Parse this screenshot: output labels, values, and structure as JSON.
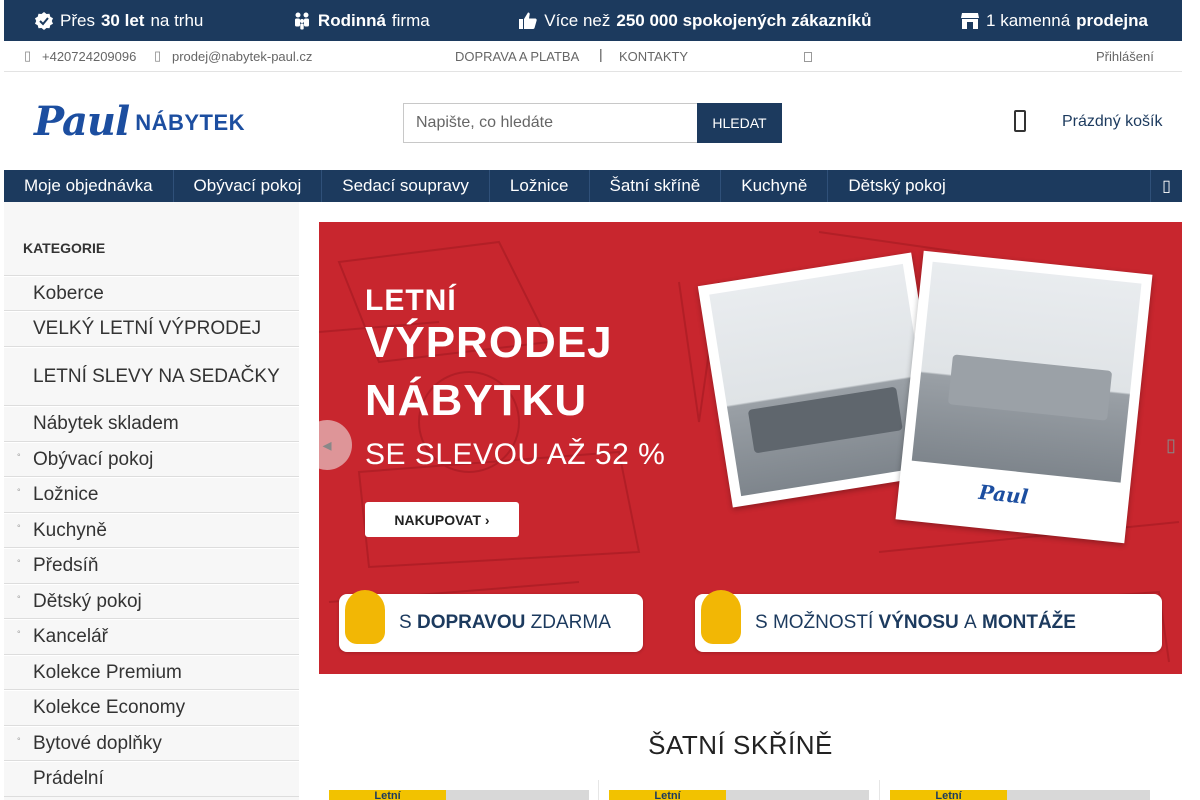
{
  "benefits": [
    {
      "icon": "badge-check-icon",
      "pre": "Přes",
      "bold": "30 let",
      "post": "na trhu"
    },
    {
      "icon": "family-icon",
      "pre": "",
      "bold": "Rodinná",
      "post": "firma"
    },
    {
      "icon": "thumbs-up-icon",
      "pre": "Více než",
      "bold": "250 000 spokojených zákazníků",
      "post": ""
    },
    {
      "icon": "store-icon",
      "pre": "1 kamenná",
      "bold": "prodejna",
      "post": ""
    }
  ],
  "contact": {
    "phone": "+420724209096",
    "email": "prodej@nabytek-paul.cz",
    "links": [
      "DOPRAVA A PLATBA",
      "KONTAKTY"
    ],
    "login": "Přihlášení"
  },
  "logo": {
    "script": "Paul",
    "text": "NÁBYTEK"
  },
  "search": {
    "placeholder": "Napište, co hledáte",
    "button": "HLEDAT"
  },
  "cart": {
    "label": "Prázdný košík"
  },
  "nav": [
    "Moje objednávka",
    "Obývací pokoj",
    "Sedací soupravy",
    "Ložnice",
    "Šatní skříně",
    "Kuchyně",
    "Dětský pokoj"
  ],
  "sidebar": {
    "title": "KATEGORIE",
    "items": [
      {
        "label": "Koberce",
        "has_children": false
      },
      {
        "label": "VELKÝ LETNÍ VÝPRODEJ",
        "has_children": false
      },
      {
        "label": "LETNÍ SLEVY NA SEDAČKY",
        "has_children": false
      },
      {
        "label": "Nábytek skladem",
        "has_children": false
      },
      {
        "label": "Obývací pokoj",
        "has_children": true
      },
      {
        "label": "Ložnice",
        "has_children": true
      },
      {
        "label": "Kuchyně",
        "has_children": true
      },
      {
        "label": "Předsíň",
        "has_children": true
      },
      {
        "label": "Dětský pokoj",
        "has_children": true
      },
      {
        "label": "Kancelář",
        "has_children": true
      },
      {
        "label": "Kolekce Premium",
        "has_children": false
      },
      {
        "label": "Kolekce Economy",
        "has_children": false
      },
      {
        "label": "Bytové doplňky",
        "has_children": true
      },
      {
        "label": "Prádelní",
        "has_children": false
      }
    ]
  },
  "banner": {
    "line1": "LETNÍ",
    "line2": "VÝPRODEJ",
    "line3": "NÁBYTKU",
    "line4": "SE SLEVOU AŽ 52 %",
    "cta": "NAKUPOVAT ›",
    "brand": "Paul",
    "pill1": {
      "pre": "S",
      "bold": "DOPRAVOU",
      "post": "ZDARMA"
    },
    "pill2": {
      "pre": "S MOŽNOSTÍ",
      "bold": "VÝNOSU",
      "mid": "A",
      "bold2": "MONTÁŽE"
    }
  },
  "section": {
    "title": "ŠATNÍ SKŘÍNĚ"
  },
  "products": [
    {
      "badge": "Letní"
    },
    {
      "badge": "Letní"
    },
    {
      "badge": "Letní"
    }
  ],
  "colors": {
    "navy": "#1c3a5e",
    "banner_red": "#c8262e",
    "accent_yellow": "#f2c200",
    "brand_blue": "#1c4ea0"
  }
}
